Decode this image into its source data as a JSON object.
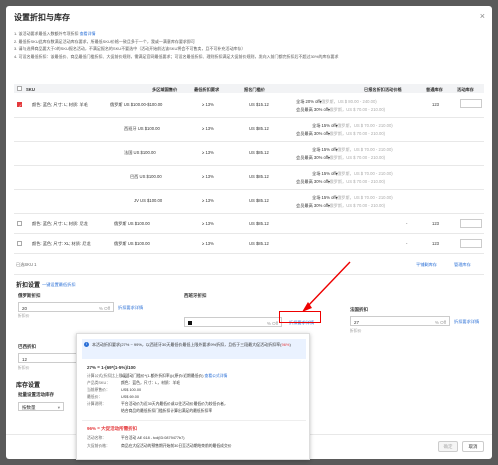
{
  "modal": {
    "title": "设置折扣与库存",
    "close": "×",
    "tips": [
      "1. 该活动要求最低入数额外专项折扣 查看详情",
      "2. 最低折SKU此库存数满足活动库存要求，所最低SKU价格一致且多于一个，我或一满意库存要求即可",
      "3. 请与选择商品要大于0的SKU报名活动，不满足报名的SKU不要选中（活动开始前达该SKU将会不可售卖，且不可补充活动库存）",
      "4. 可设名最低折扣：该最低价、商品最低门槛折扣、大促前价规则，需满足官网最低要求；可设名最低折扣、理则折扣满足大促前价规则，发向入前门都完折扣后不超过30%的库存要求"
    ],
    "tips_link": "查看详情"
  },
  "table": {
    "headers": [
      "SKU",
      "多区域国售价",
      "最低折扣要求",
      "报名门槛价",
      "已报名折扣活动价格",
      "普通库存",
      "活动库存"
    ],
    "rows": [
      {
        "checked": true,
        "sku": "颜色: 蓝色; 尺寸: L; 材质: 羊毛",
        "price": "俄罗斯 US $100.00-$100.00",
        "req": "≥ 13%",
        "thr": "US $15.12",
        "line1": "全场 20% off (俄罗斯，US $ 80.00 - 240.00)",
        "line2": "会员最高 30% off (俄罗斯，US $ 70.00 - 210.00)",
        "stock": "123"
      },
      {
        "checked": false,
        "sku": "",
        "price": "西班牙 US $100.00",
        "req": "≥ 13%",
        "thr": "US $85.12",
        "line1": "全场 15% off (俄罗斯，US $ 70.00 - 210.00)",
        "line2": "会员最高 30% off (俄罗斯，US $ 70.00 - 210.00)",
        "stock": ""
      },
      {
        "checked": false,
        "sku": "",
        "price": "法国 US $100.00",
        "req": "≥ 13%",
        "thr": "US $85.12",
        "line1": "全场 15% off (俄罗斯，US $ 70.00 - 210.00)",
        "line2": "会员最高 30% off (俄罗斯，US $ 70.00 - 210.00)",
        "stock": ""
      },
      {
        "checked": false,
        "sku": "",
        "price": "巴西 US $100.00",
        "req": "≥ 13%",
        "thr": "US $85.12",
        "line1": "全场 15% off (俄罗斯，US $ 70.00 - 210.00)",
        "line2": "会员最高 30% off (俄罗斯，US $ 70.00 - 210.00)",
        "stock": ""
      },
      {
        "checked": false,
        "sku": "",
        "price": "JV US $100.00",
        "req": "≥ 13%",
        "thr": "US $85.12",
        "line1": "全场 15% off (俄罗斯，US $ 70.00 - 210.00)",
        "line2": "会员最高 30% off (俄罗斯，US $ 70.00 - 210.00)",
        "stock": ""
      },
      {
        "checked": false,
        "sku": "颜色: 蓝色; 尺寸: L; 材质: 尼龙",
        "price": "俄罗斯 US $100.00",
        "req": "≥ 13%",
        "thr": "US $85.12",
        "line1": "-",
        "line2": "",
        "stock": "123"
      },
      {
        "checked": false,
        "sku": "颜色: 蓝色; 尺寸: XL; 材质: 尼龙",
        "price": "俄罗斯 US $100.00",
        "req": "≥ 13%",
        "thr": "US $85.12",
        "line1": "-",
        "line2": "",
        "stock": "123"
      }
    ],
    "selected": "已选SKU 1",
    "batch_links": [
      "平铺剩库存",
      "管理库存"
    ]
  },
  "discount": {
    "section": "折扣设置",
    "batch_link": "一键设置最低折扣",
    "col1_label": "俄罗斯折扣",
    "col1_value": "20",
    "col1_unit": "% Off",
    "col1_link": "折扣要求详情",
    "col1_hint": "折扣价",
    "col2_label": "西班牙折扣",
    "col2_unit": "% Off",
    "col2_link": "折扣要求详情",
    "col3_label": "法国折扣",
    "col3_value": "27",
    "col3_unit": "% Off",
    "col3_link": "折扣要求详情",
    "col3_hint": "折扣价",
    "col4_label": "巴西折扣",
    "col4_value": "12",
    "col4_hint": "折扣价"
  },
  "stock": {
    "section": "库存设置",
    "label": "批量设置活动库存",
    "select_value": "按数量",
    "chevron": "▾"
  },
  "popup": {
    "icon": "i",
    "notice_pre": "本活动折扣要求(27% ~ 99%，以西班牙30天最低价最低上限外要求9%折扣，且低于三段最大促活动折扣率(",
    "notice_red": "96%",
    "notice_post": ")",
    "formula_title": "27% = 1-(69*(1-5%)/100",
    "rows": [
      {
        "k": "计算公式(折扣比上限值)：",
        "v": "1-(活动门槛价*(1-额外折扣率))/(原价/近期最低价)",
        "link": "查看公式详情"
      },
      {
        "k": "产品类SKU：",
        "v": "颜色：蓝色，尺寸：L，材质：羊毛",
        "link": ""
      },
      {
        "k": "当前原售价：",
        "v": "US$ 100.00",
        "link": ""
      },
      {
        "k": "最低价：",
        "v": "US$ 69.00",
        "link": ""
      },
      {
        "k": "计算说明：",
        "v": "平台活动价为近30天内最低价或以往活动价最低价为较低价者，",
        "link": ""
      },
      {
        "k": "",
        "v": "结合商品的最低折扣门槛折扣计算出满足的最低折扣率",
        "link": ""
      }
    ],
    "part2_title": "96% = 大促活动所需折扣",
    "part2_rows": [
      {
        "k": "活动名称：",
        "v": "平台活动 AE 618 - tcd(ID:0879477b7)"
      },
      {
        "k": "大促前价格：",
        "v": "商品在大促活动的预售期开始前30日至活动期结束前的最低成交价"
      }
    ]
  },
  "footer": {
    "confirm": "确定",
    "cancel": "取消"
  }
}
